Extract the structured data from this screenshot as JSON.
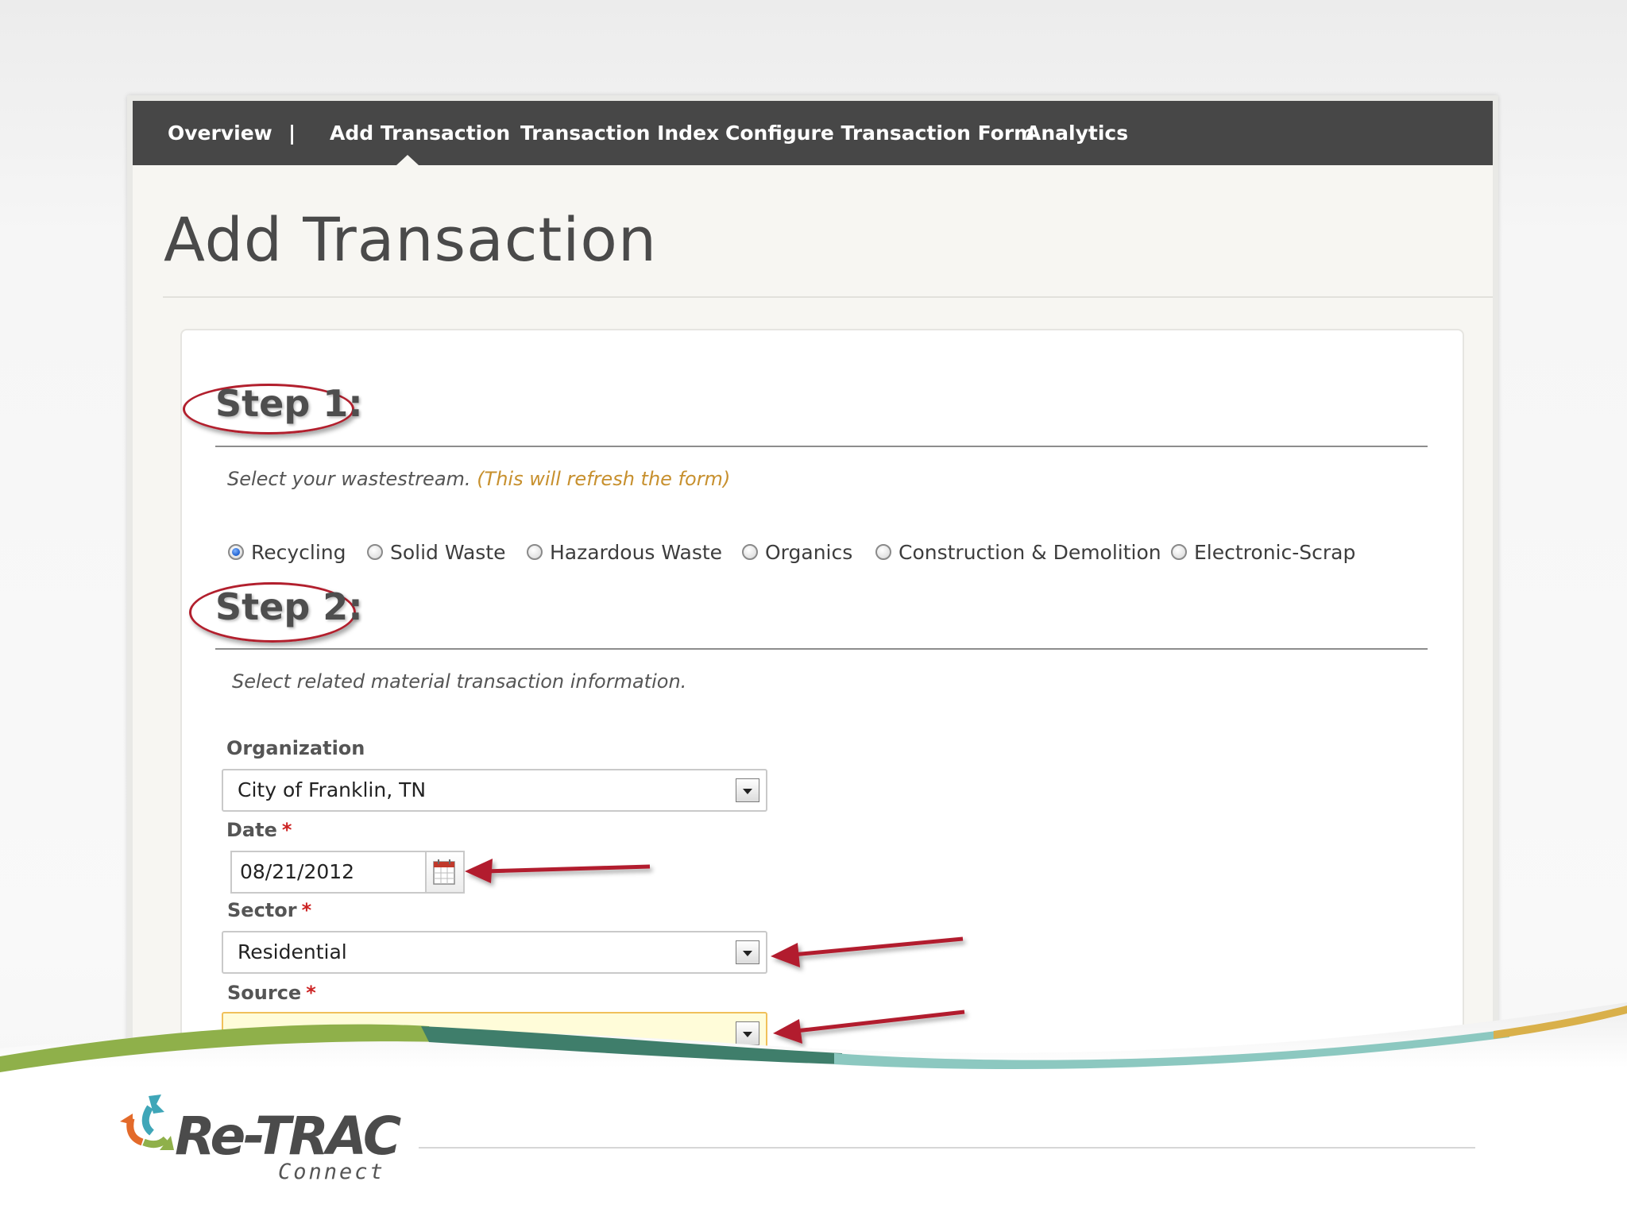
{
  "nav": {
    "items": [
      {
        "label": "Overview"
      },
      {
        "label": "|"
      },
      {
        "label": "Add Transaction"
      },
      {
        "label": "Transaction Index"
      },
      {
        "label": "Configure Transaction Form"
      },
      {
        "label": "Analytics"
      }
    ],
    "active": "Add Transaction"
  },
  "page": {
    "title": "Add Transaction"
  },
  "step1": {
    "label": "Step 1:",
    "instruction": "Select your wastestream.",
    "note": "(This will refresh the form)",
    "options": [
      {
        "label": "Recycling",
        "checked": true
      },
      {
        "label": "Solid Waste",
        "checked": false
      },
      {
        "label": "Hazardous Waste",
        "checked": false
      },
      {
        "label": "Organics",
        "checked": false
      },
      {
        "label": "Construction & Demolition",
        "checked": false
      },
      {
        "label": "Electronic-Scrap",
        "checked": false
      }
    ]
  },
  "step2": {
    "label": "Step 2:",
    "instruction": "Select related material transaction information.",
    "organization": {
      "label": "Organization",
      "value": "City of Franklin, TN"
    },
    "date": {
      "label": "Date",
      "required": "*",
      "value": "08/21/2012"
    },
    "sector": {
      "label": "Sector",
      "required": "*",
      "value": "Residential"
    },
    "source": {
      "label": "Source",
      "required": "*",
      "value": ""
    }
  },
  "brand": {
    "logo": "Re-TRAC",
    "sub": "Connect"
  },
  "colors": {
    "nav_bg": "#474747",
    "annotation_red": "#b21f2d",
    "note_orange": "#c7902e",
    "wave_green": "#8fb04a",
    "wave_teal": "#3f7e6b",
    "wave_aqua": "#8cc8c0",
    "wave_gold": "#d9b04a"
  }
}
